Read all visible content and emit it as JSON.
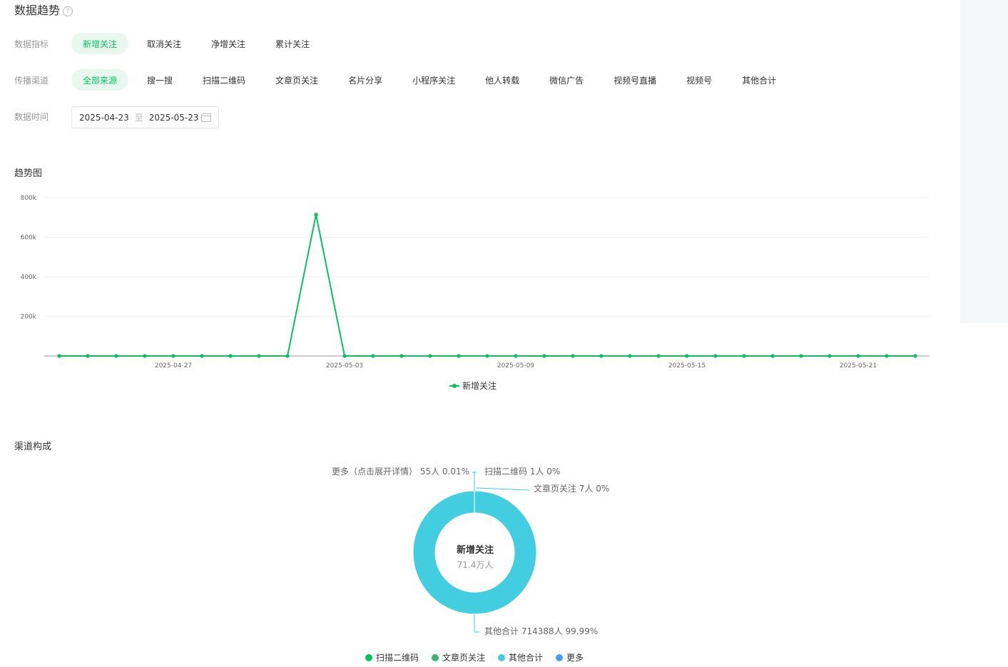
{
  "header": {
    "title": "数据趋势",
    "help_icon": "?"
  },
  "filters": {
    "metric": {
      "label": "数据指标",
      "options": [
        "新增关注",
        "取消关注",
        "净增关注",
        "累计关注"
      ],
      "selected": "新增关注"
    },
    "channel": {
      "label": "传播渠道",
      "options": [
        "全部来源",
        "搜一搜",
        "扫描二维码",
        "文章页关注",
        "名片分享",
        "小程序关注",
        "他人转载",
        "微信广告",
        "视频号直播",
        "视频号",
        "其他合计"
      ],
      "selected": "全部来源"
    },
    "date": {
      "label": "数据时间",
      "start": "2025-04-23",
      "separator": "至",
      "end": "2025-05-23"
    }
  },
  "trend": {
    "subtitle": "趋势图",
    "legend_label": "新增关注"
  },
  "composition": {
    "subtitle": "渠道构成",
    "center_title": "新增关注",
    "center_value": "71.4万人",
    "labels": {
      "more": "更多（点击展开详情） 55人 0.01%",
      "scan": "扫描二维码 1人 0%",
      "article": "文章页关注 7人 0%",
      "other": "其他合计 714388人 99.99%"
    },
    "legend": [
      {
        "name": "扫描二维码",
        "color": "#07c160"
      },
      {
        "name": "文章页关注",
        "color": "#3eb575"
      },
      {
        "name": "其他合计",
        "color": "#42cde0"
      },
      {
        "name": "更多",
        "color": "#4a9ee8"
      }
    ]
  },
  "colors": {
    "accent": "#07c160",
    "donut": "#42cde0"
  },
  "chart_data": [
    {
      "type": "line",
      "title": "趋势图",
      "x": [
        "2025-04-23",
        "2025-04-24",
        "2025-04-25",
        "2025-04-26",
        "2025-04-27",
        "2025-04-28",
        "2025-04-29",
        "2025-04-30",
        "2025-05-01",
        "2025-05-02",
        "2025-05-03",
        "2025-05-04",
        "2025-05-05",
        "2025-05-06",
        "2025-05-07",
        "2025-05-08",
        "2025-05-09",
        "2025-05-10",
        "2025-05-11",
        "2025-05-12",
        "2025-05-13",
        "2025-05-14",
        "2025-05-15",
        "2025-05-16",
        "2025-05-17",
        "2025-05-18",
        "2025-05-19",
        "2025-05-20",
        "2025-05-21",
        "2025-05-22",
        "2025-05-23"
      ],
      "x_tick_labels": [
        "2025-04-27",
        "2025-05-03",
        "2025-05-09",
        "2025-05-15",
        "2025-05-21"
      ],
      "series": [
        {
          "name": "新增关注",
          "values": [
            0,
            0,
            0,
            0,
            0,
            0,
            0,
            0,
            0,
            714000,
            0,
            0,
            0,
            0,
            0,
            0,
            0,
            0,
            0,
            0,
            0,
            0,
            0,
            0,
            0,
            0,
            0,
            0,
            0,
            0,
            0
          ]
        }
      ],
      "y_ticks": [
        "200k",
        "400k",
        "600k",
        "800k"
      ],
      "ylim": [
        0,
        800000
      ],
      "grid": true,
      "legend": "bottom"
    },
    {
      "type": "pie",
      "title": "渠道构成",
      "slices": [
        {
          "name": "扫描二维码",
          "value": 1,
          "percent": 0
        },
        {
          "name": "文章页关注",
          "value": 7,
          "percent": 0
        },
        {
          "name": "其他合计",
          "value": 714388,
          "percent": 99.99
        },
        {
          "name": "更多",
          "value": 55,
          "percent": 0.01
        }
      ]
    }
  ]
}
